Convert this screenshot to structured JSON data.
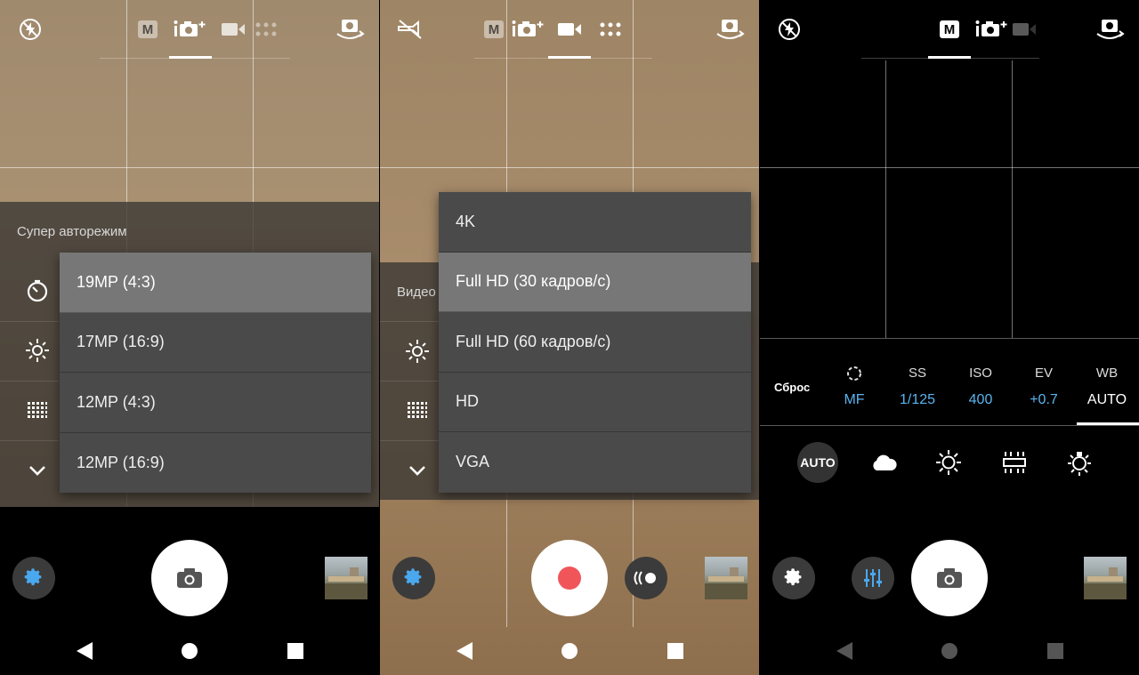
{
  "screens": [
    {
      "settings_title": "Супер авторежим",
      "resolution_options": [
        "19MP (4:3)",
        "17MP (16:9)",
        "12MP (4:3)",
        "12MP (16:9)"
      ],
      "selected_index": 0
    },
    {
      "settings_title": "Видео",
      "video_options": [
        "4K",
        "Full HD (30 кадров/с)",
        "Full HD (60 кадров/с)",
        "HD",
        "VGA"
      ],
      "selected_index": 1
    },
    {
      "reset_label": "Сброс",
      "manual_controls": [
        {
          "label": "",
          "value": "MF",
          "icon": "focus-icon"
        },
        {
          "label": "SS",
          "value": "1/125"
        },
        {
          "label": "ISO",
          "value": "400"
        },
        {
          "label": "EV",
          "value": "+0.7"
        },
        {
          "label": "WB",
          "value": "AUTO"
        }
      ],
      "wb_auto_label": "AUTO",
      "wb_presets": [
        "auto",
        "cloudy-icon",
        "daylight-icon",
        "fluorescent-icon",
        "incandescent-icon"
      ]
    }
  ],
  "mode_badge": "M",
  "colors": {
    "accent_blue": "#5ab4f0",
    "record_red": "#f0555a"
  }
}
